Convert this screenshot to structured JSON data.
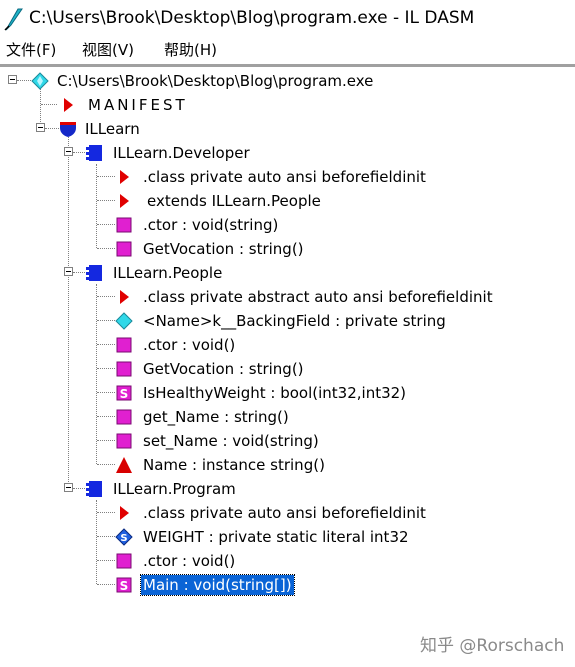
{
  "window": {
    "title": "C:\\Users\\Brook\\Desktop\\Blog\\program.exe - IL DASM"
  },
  "menu": [
    "文件(F)",
    "视图(V)",
    "帮助(H)"
  ],
  "tree": {
    "root": "C:\\Users\\Brook\\Desktop\\Blog\\program.exe",
    "manifest": "MANIFEST",
    "namespace": "ILLearn",
    "classes": [
      {
        "name": "ILLearn.Developer",
        "members": [
          ".class private auto ansi beforefieldinit",
          "extends ILLearn.People",
          ".ctor : void(string)",
          "GetVocation : string()"
        ]
      },
      {
        "name": "ILLearn.People",
        "members": [
          ".class private abstract auto ansi beforefieldinit",
          "<Name>k__BackingField : private string",
          ".ctor : void()",
          "GetVocation : string()",
          "IsHealthyWeight : bool(int32,int32)",
          "get_Name : string()",
          "set_Name : void(string)",
          "Name : instance string()"
        ]
      },
      {
        "name": "ILLearn.Program",
        "members": [
          ".class private auto ansi beforefieldinit",
          "WEIGHT : private static literal int32",
          ".ctor : void()",
          "Main : void(string[])"
        ]
      }
    ]
  },
  "selected_item": "Main : void(string[])",
  "icons": {
    "app": "ildasm-quill-icon",
    "root": "assembly-diamond-icon",
    "manifest": "red-triangle-icon",
    "namespace": "namespace-shield-icon",
    "class": "class-icon",
    "class-info": "red-triangle-icon",
    "field": "field-diamond-icon",
    "method": "method-square-icon",
    "static-method": "static-method-icon",
    "property": "property-triangle-icon",
    "static-field": "static-field-icon"
  },
  "watermark": "知乎 @Rorschach"
}
